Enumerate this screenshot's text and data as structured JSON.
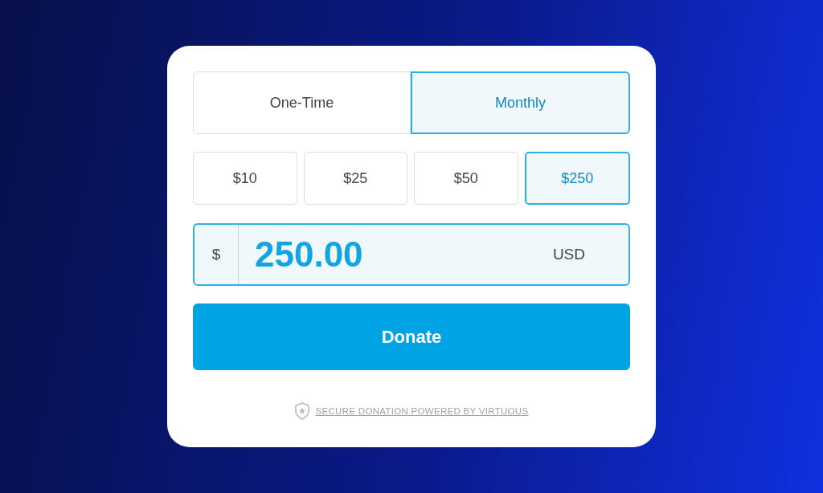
{
  "frequency": [
    {
      "label": "One-Time",
      "selected": false
    },
    {
      "label": "Monthly",
      "selected": true
    }
  ],
  "amounts": [
    {
      "label": "$10",
      "selected": false
    },
    {
      "label": "$25",
      "selected": false
    },
    {
      "label": "$50",
      "selected": false
    },
    {
      "label": "$250",
      "selected": true
    }
  ],
  "amount_field": {
    "prefix": "$",
    "value": "250.00",
    "currency": "USD"
  },
  "donate_button": "Donate",
  "footer": "SECURE DONATION POWERED BY VIRTUOUS"
}
